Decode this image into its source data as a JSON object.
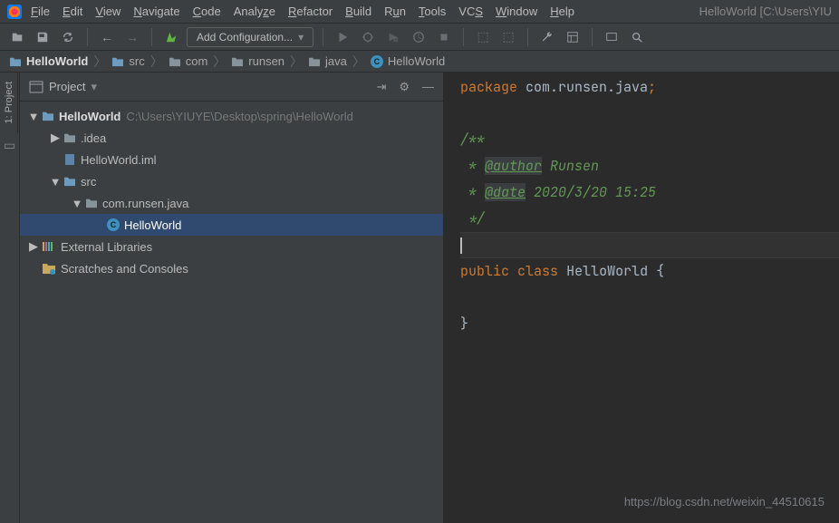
{
  "window": {
    "title": "HelloWorld [C:\\Users\\YIU"
  },
  "menu": {
    "file": "File",
    "edit": "Edit",
    "view": "View",
    "navigate": "Navigate",
    "code": "Code",
    "analyze": "Analyze",
    "refactor": "Refactor",
    "build": "Build",
    "run": "Run",
    "tools": "Tools",
    "vcs": "VCS",
    "window": "Window",
    "help": "Help"
  },
  "toolbar": {
    "config": "Add Configuration..."
  },
  "breadcrumbs": [
    "HelloWorld",
    "src",
    "com",
    "runsen",
    "java",
    "HelloWorld"
  ],
  "projectPanel": {
    "title": "Project",
    "sideTab": "1: Project"
  },
  "tree": {
    "root": {
      "name": "HelloWorld",
      "path": "C:\\Users\\YIUYE\\Desktop\\spring\\HelloWorld"
    },
    "idea": ".idea",
    "iml": "HelloWorld.iml",
    "src": "src",
    "pkg": "com.runsen.java",
    "class": "HelloWorld",
    "ext": "External Libraries",
    "scratch": "Scratches and Consoles"
  },
  "code": {
    "package_kw": "package",
    "package_name": "com.runsen.java",
    "doc_open": "/**",
    "author_tag": "@author",
    "author_val": " Runsen",
    "date_tag": "@date",
    "date_val": " 2020/3/20 15:25",
    "doc_close": " */",
    "public": "public",
    "class": "class",
    "cls_name": "HelloWorld",
    "brace_open": " {",
    "brace_close": "}"
  },
  "watermark": "https://blog.csdn.net/weixin_44510615"
}
